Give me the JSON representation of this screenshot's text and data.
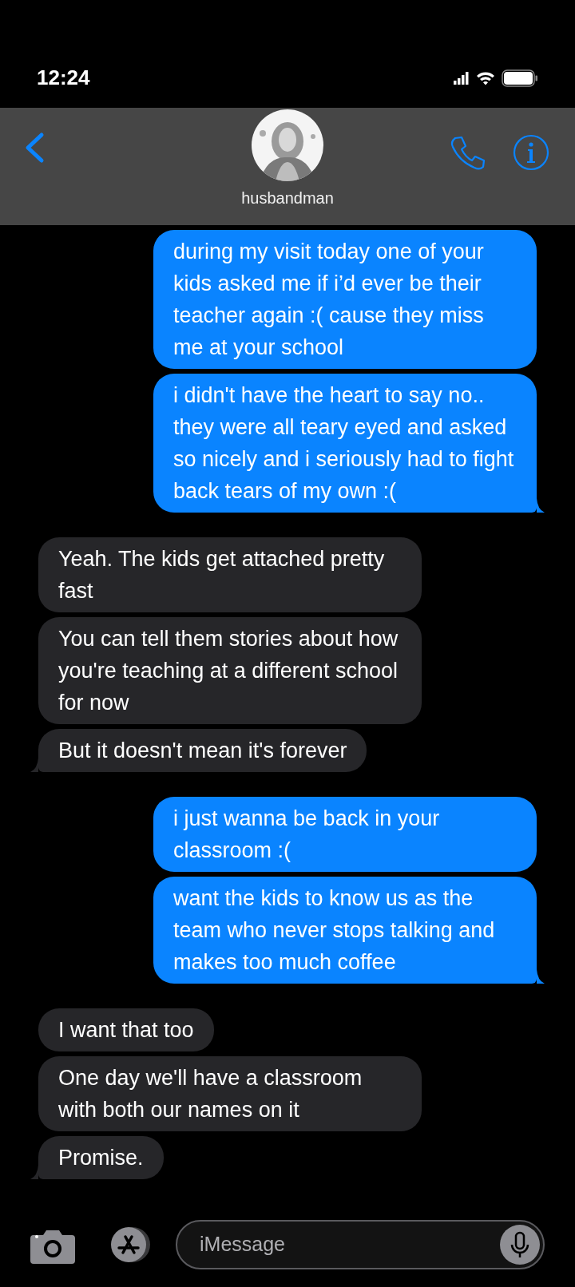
{
  "status_bar": {
    "time": "12:24"
  },
  "header": {
    "contact_name": "husbandman"
  },
  "conversation": [
    {
      "kind": "sent",
      "messages": [
        "during my visit today one of your kids asked me if i’d ever be their teacher again :( cause they miss me at your school",
        "i didn't have the heart to say no.. they were all teary eyed and asked so nicely and i seriously had to fight back tears of my own :("
      ]
    },
    {
      "kind": "received",
      "messages": [
        "Yeah. The kids get attached pretty fast",
        "You can tell them stories about how you're teaching at a different school for now",
        "But it doesn't mean it's forever"
      ]
    },
    {
      "kind": "sent",
      "messages": [
        "i just wanna be back in your classroom :(",
        "want the kids to know us as the team who never stops talking and makes too much coffee"
      ]
    },
    {
      "kind": "received",
      "messages": [
        "I want that too",
        "One day we'll have a classroom with both our names on it",
        "Promise."
      ]
    }
  ],
  "composer": {
    "placeholder": "iMessage"
  }
}
